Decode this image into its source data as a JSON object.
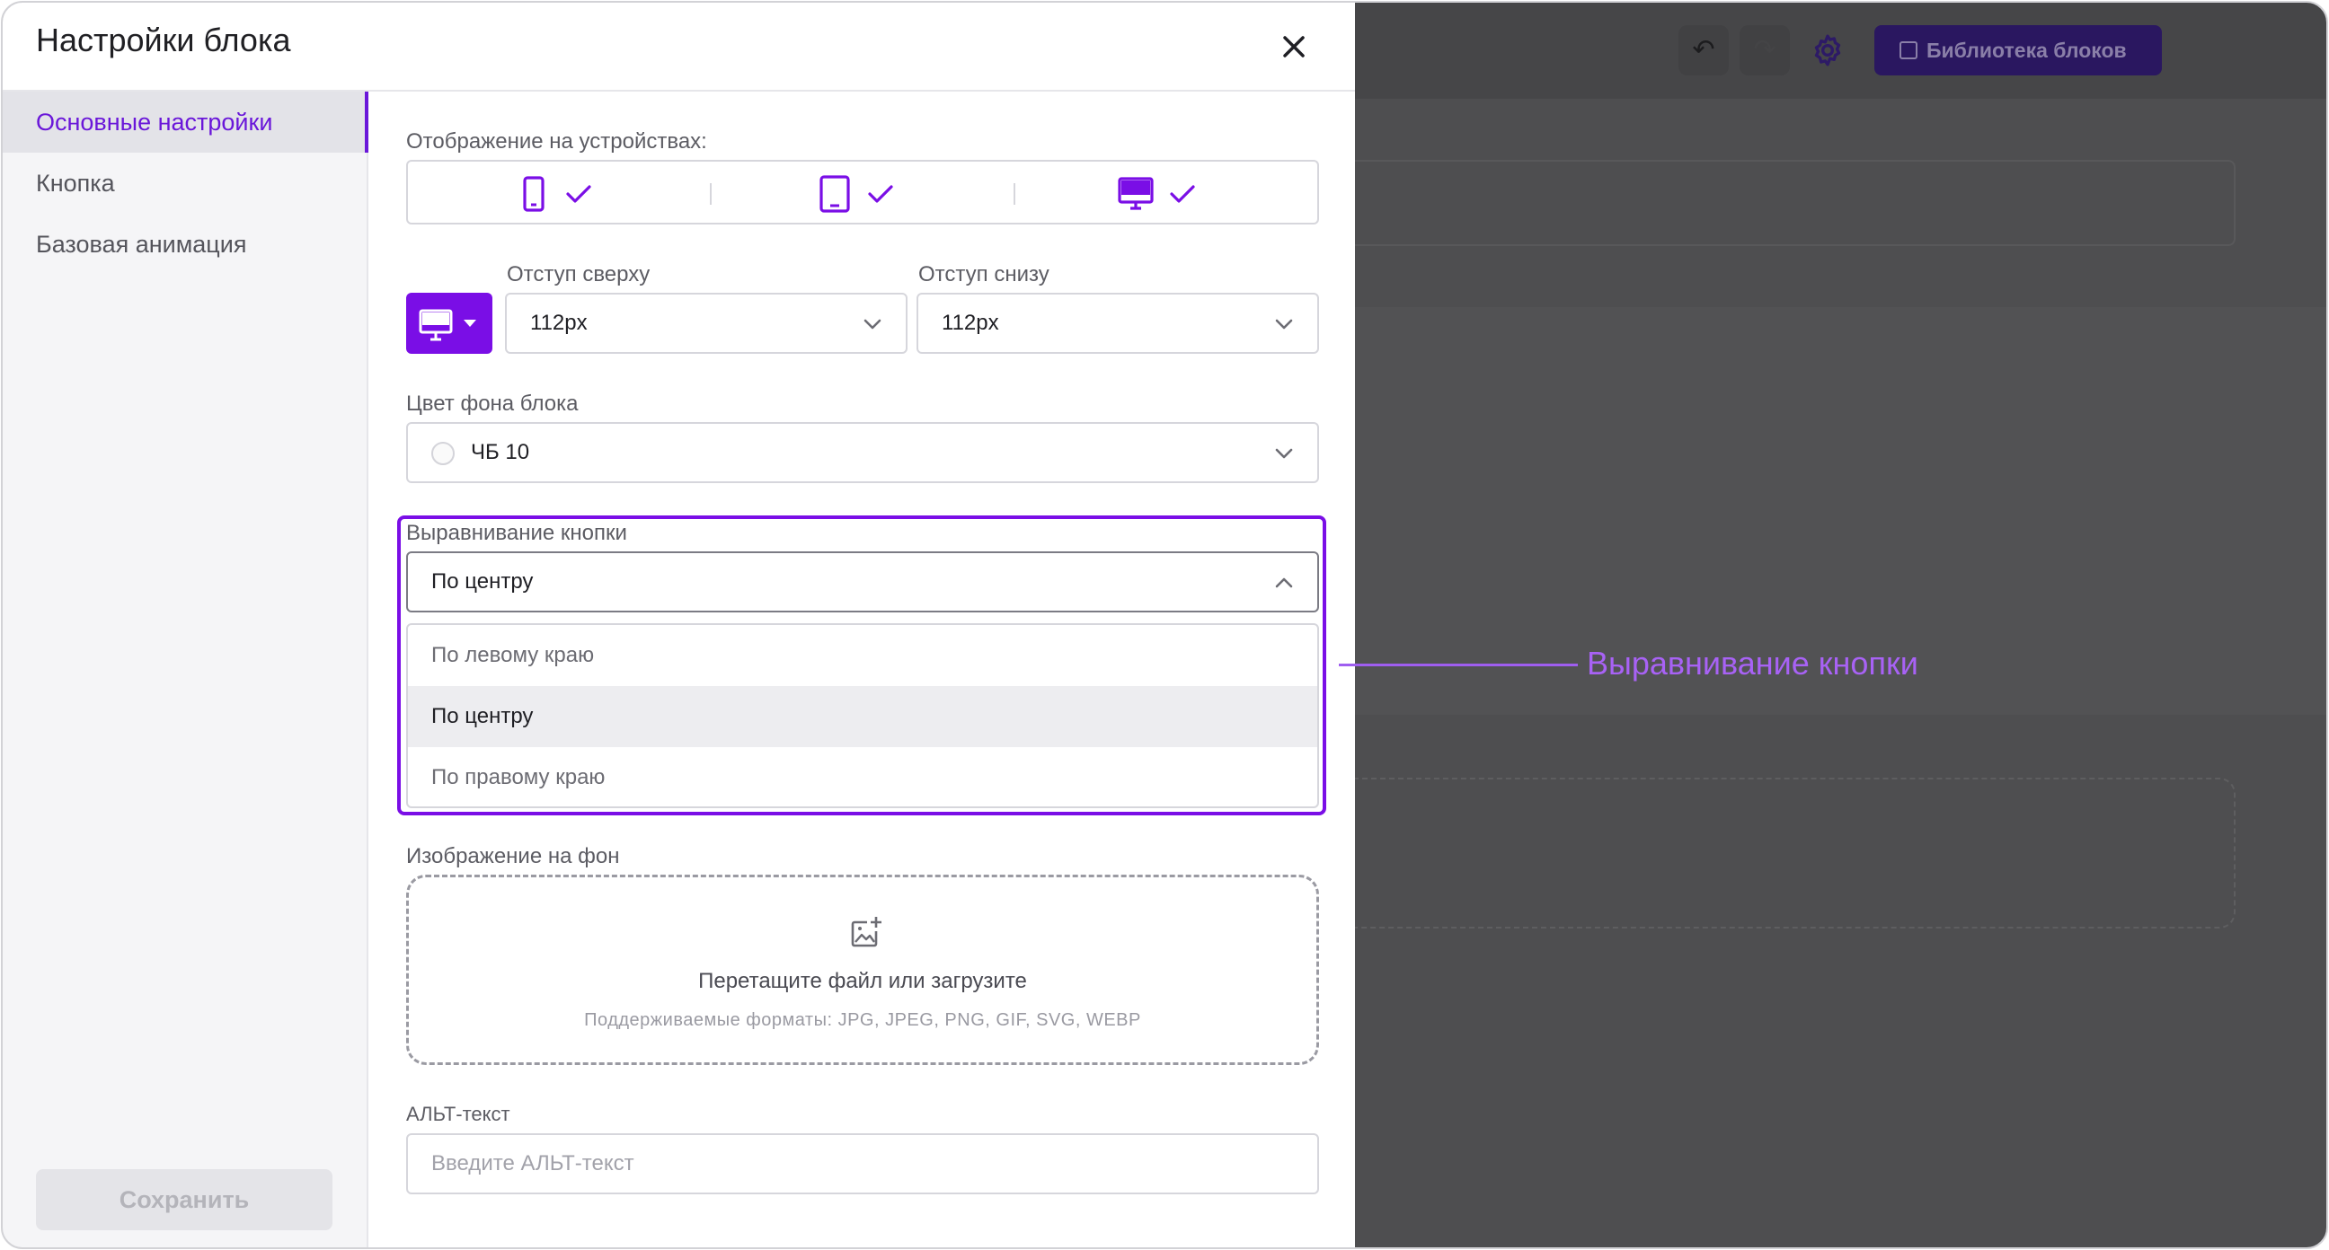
{
  "editor": {
    "undo_icon": "undo-icon",
    "redo_icon": "redo-icon",
    "settings_icon": "gear-icon",
    "library_button": "Библиотека блоков"
  },
  "modal": {
    "title": "Настройки блока",
    "close_icon": "close-icon"
  },
  "sidebar": {
    "items": [
      {
        "label": "Основные настройки",
        "active": true
      },
      {
        "label": "Кнопка",
        "active": false
      },
      {
        "label": "Базовая анимация",
        "active": false
      }
    ],
    "save_label": "Сохранить"
  },
  "devices": {
    "label": "Отображение на устройствах:",
    "items": [
      {
        "name": "mobile-icon",
        "checked": true
      },
      {
        "name": "tablet-icon",
        "checked": true
      },
      {
        "name": "desktop-icon",
        "checked": true
      }
    ]
  },
  "spacing": {
    "device_toggle_icon": "desktop-icon",
    "top_label": "Отступ сверху",
    "top_value": "112px",
    "bottom_label": "Отступ снизу",
    "bottom_value": "112px"
  },
  "background_color": {
    "label": "Цвет фона блока",
    "value": "ЧБ 10"
  },
  "button_alignment": {
    "label": "Выравнивание кнопки",
    "value": "По центру",
    "options": [
      "По левому краю",
      "По центру",
      "По правому краю"
    ],
    "selected_index": 1
  },
  "background_image": {
    "label": "Изображение на фон",
    "drop_text": "Перетащите файл или загрузите",
    "formats": "Поддерживаемые форматы: JPG, JPEG, PNG, GIF, SVG, WEBP"
  },
  "alt_text": {
    "label": "АЛЬТ-текст",
    "placeholder": "Введите АЛЬТ-текст"
  },
  "callout": {
    "text": "Выравнивание кнопки"
  },
  "colors": {
    "accent": "#7a0ee6",
    "callout": "#a862f5",
    "overlay": "#4e4e50"
  }
}
